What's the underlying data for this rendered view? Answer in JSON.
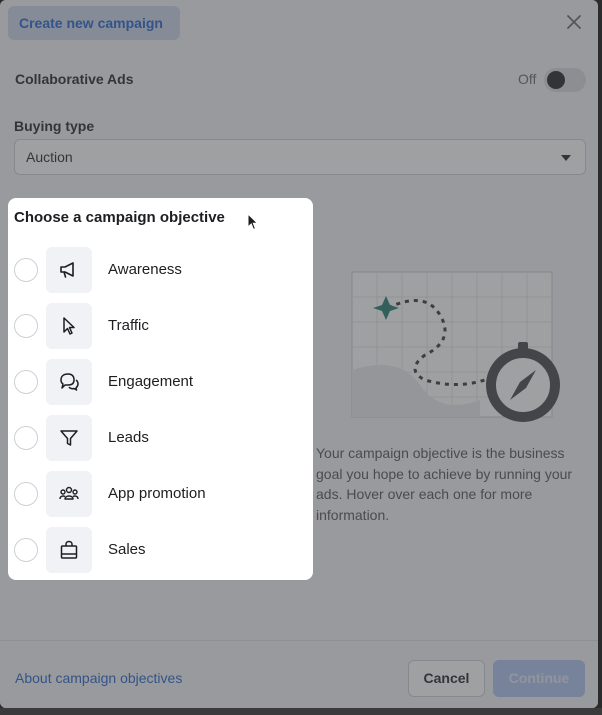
{
  "header": {
    "title": "Create new campaign"
  },
  "collaborative_ads": {
    "label": "Collaborative Ads",
    "toggle_state": "Off"
  },
  "buying_type": {
    "label": "Buying type",
    "value": "Auction"
  },
  "objective_panel": {
    "title": "Choose a campaign objective",
    "options": [
      {
        "label": "Awareness",
        "icon": "megaphone-icon"
      },
      {
        "label": "Traffic",
        "icon": "cursor-icon"
      },
      {
        "label": "Engagement",
        "icon": "chat-bubbles-icon"
      },
      {
        "label": "Leads",
        "icon": "filter-icon"
      },
      {
        "label": "App promotion",
        "icon": "people-icon"
      },
      {
        "label": "Sales",
        "icon": "shopping-bag-icon"
      }
    ]
  },
  "description": "Your campaign objective is the business goal you hope to achieve by running your ads. Hover over each one for more information.",
  "footer": {
    "about_link": "About campaign objectives",
    "cancel_label": "Cancel",
    "continue_label": "Continue"
  },
  "colors": {
    "link": "#1f5fcc",
    "overlay": "#46484c",
    "accent_teal": "#1e7a6c"
  }
}
